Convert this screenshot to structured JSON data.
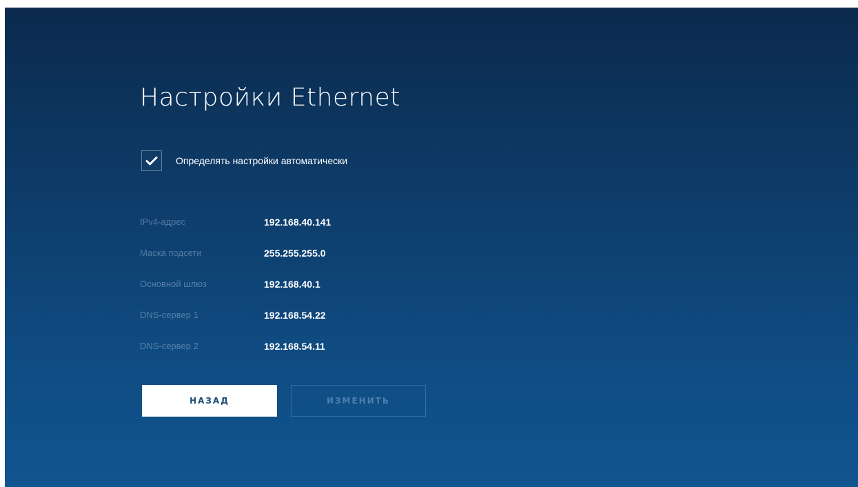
{
  "title": "Настройки Ethernet",
  "auto_settings": {
    "label": "Определять настройки автоматически",
    "checked": true
  },
  "settings": [
    {
      "label": "IPv4-адрес",
      "value": "192.168.40.141"
    },
    {
      "label": "Маска подсети",
      "value": "255.255.255.0"
    },
    {
      "label": "Основной шлюз",
      "value": "192.168.40.1"
    },
    {
      "label": "DNS-сервер 1",
      "value": "192.168.54.22"
    },
    {
      "label": "DNS-сервер 2",
      "value": "192.168.54.11"
    }
  ],
  "buttons": {
    "back_label": "НАЗАД",
    "edit_label": "ИЗМЕНИТЬ"
  },
  "colors": {
    "background_top": "#0b2a4d",
    "background_bottom": "#11558f",
    "button_text": "#1c4a78"
  }
}
